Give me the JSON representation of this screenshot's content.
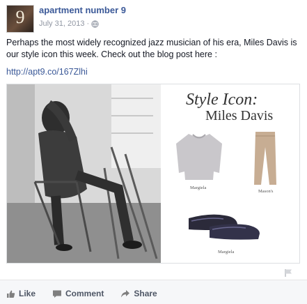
{
  "post": {
    "page_name": "apartment number 9",
    "avatar_text": "9",
    "date": "July 31, 2013",
    "separator": "·",
    "privacy_icon": "globe-icon",
    "message": "Perhaps the most widely recognized jazz musician of his era, Miles Davis is our style icon this week. Check out the blog post here :",
    "link": "http://apt9.co/167Zlhi"
  },
  "attachment": {
    "title": "Style Icon:",
    "subtitle": "Miles Davis",
    "items": [
      {
        "label": "Margiela"
      },
      {
        "label": "Mason's"
      },
      {
        "label": "Margiela"
      }
    ]
  },
  "actions": {
    "like": "Like",
    "comment": "Comment",
    "share": "Share"
  },
  "colors": {
    "link": "#3b5998",
    "muted": "#9197a3",
    "action": "#4e5665"
  }
}
